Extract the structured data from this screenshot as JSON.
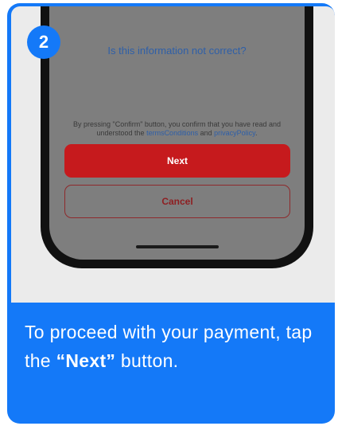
{
  "step": {
    "number": "2"
  },
  "phone": {
    "question_link": "Is this information not correct?",
    "consent": {
      "prefix": "By pressing \"Confirm\" button, you confirm that you have read and understood the ",
      "terms_link": "termsConditions",
      "middle": " and ",
      "privacy_link": "privacyPolicy",
      "suffix": "."
    },
    "next_label": "Next",
    "cancel_label": "Cancel"
  },
  "instruction": {
    "before": "To proceed with your payment, tap the ",
    "emphasis": "“Next”",
    "after": " button."
  },
  "colors": {
    "accent_blue": "#1479f8",
    "primary_red": "#c61a1d",
    "link_blue": "#2e5fa8"
  }
}
